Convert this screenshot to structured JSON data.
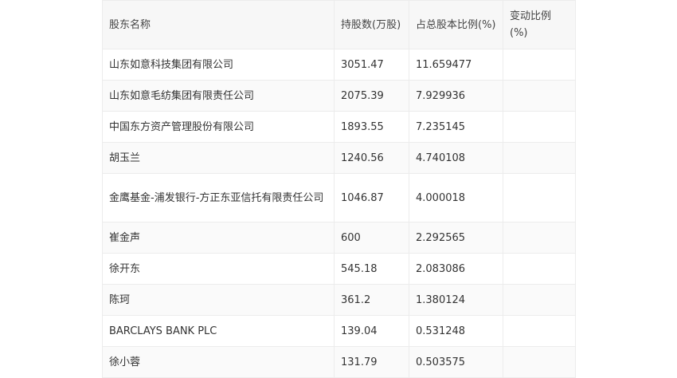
{
  "table": {
    "headers": [
      "股东名称",
      "持股数(万股)",
      "占总股本比例(%)",
      "变动比例(%)"
    ],
    "rows": [
      [
        "山东如意科技集团有限公司",
        "3051.47",
        "11.659477",
        ""
      ],
      [
        "山东如意毛纺集团有限责任公司",
        "2075.39",
        "7.929936",
        ""
      ],
      [
        "中国东方资产管理股份有限公司",
        "1893.55",
        "7.235145",
        ""
      ],
      [
        "胡玉兰",
        "1240.56",
        "4.740108",
        ""
      ],
      [
        "金鹰基金-浦发银行-方正东亚信托有限责任公司",
        "1046.87",
        "4.000018",
        ""
      ],
      [
        "崔金声",
        "600",
        "2.292565",
        ""
      ],
      [
        "徐开东",
        "545.18",
        "2.083086",
        ""
      ],
      [
        "陈珂",
        "361.2",
        "1.380124",
        ""
      ],
      [
        "BARCLAYS BANK PLC",
        "139.04",
        "0.531248",
        ""
      ],
      [
        "徐小蓉",
        "131.79",
        "0.503575",
        ""
      ]
    ]
  }
}
